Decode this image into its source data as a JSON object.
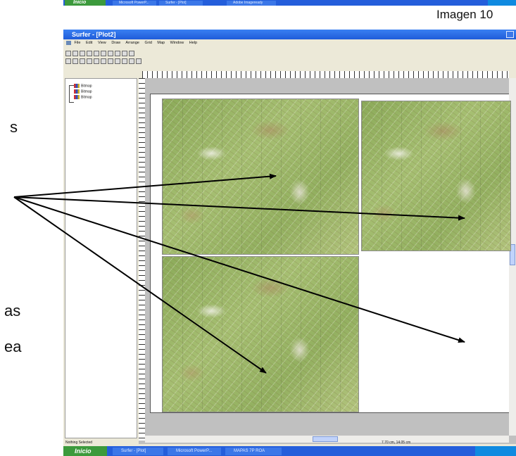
{
  "slide": {
    "caption": "Imagen 10",
    "left_text_1": "s",
    "left_text_2": "as",
    "left_text_3": "ea"
  },
  "top_taskbar": {
    "start_label": "Inicio",
    "buttons": [
      "Microsoft PowerP...",
      "Surfer - [Plot]",
      "Adobe Imageready"
    ]
  },
  "window": {
    "title": "Surfer - [Plot2]",
    "menu": [
      "File",
      "Edit",
      "View",
      "Draw",
      "Arrange",
      "Grid",
      "Map",
      "Window",
      "Help"
    ]
  },
  "object_manager": {
    "items": [
      "Bitmap",
      "Bitmap",
      "Bitmap"
    ]
  },
  "status": {
    "left": "Nothing Selected",
    "right": "7.70 cm, 14.05 cm"
  },
  "bottom_taskbar": {
    "start_label": "Inicio",
    "buttons": [
      "Surfer - [Plot]",
      "Microsoft PowerP...",
      "MAPAS 7P ROA"
    ]
  },
  "colors": {
    "taskbar": "#245edb",
    "start": "#3c9a3c",
    "titlebar": "#1f5cd9",
    "window_bg": "#ece9d8",
    "arrow": "#000000"
  }
}
